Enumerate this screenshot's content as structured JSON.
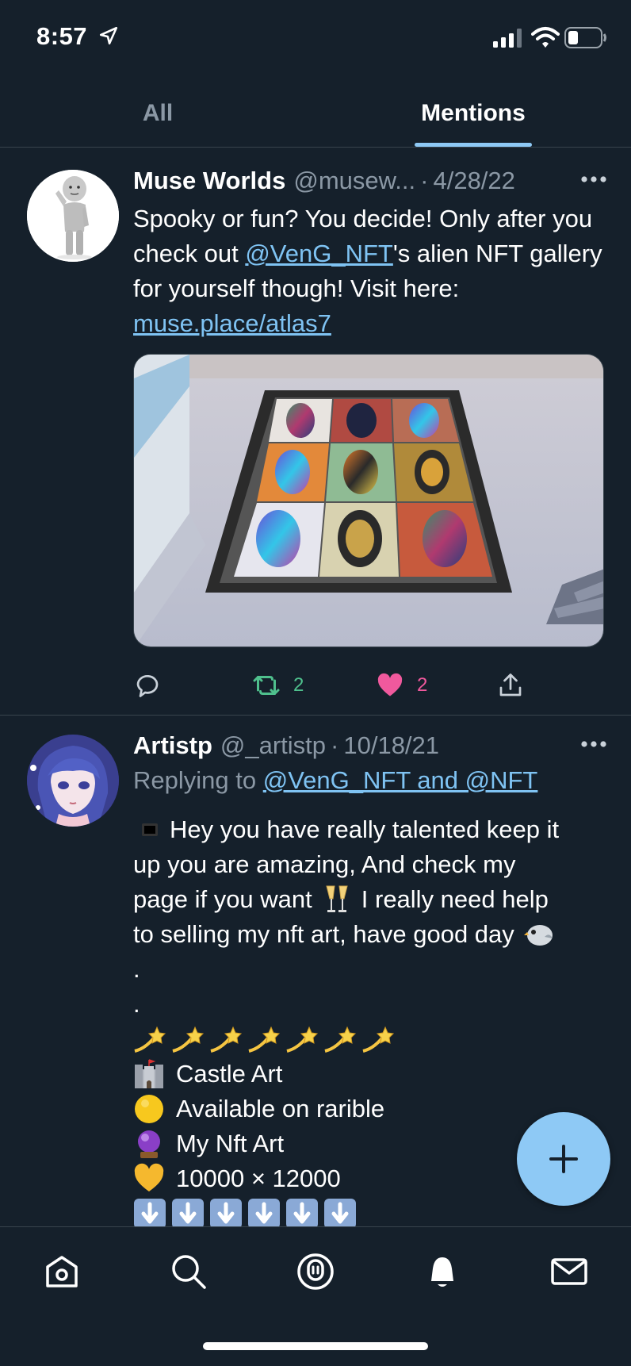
{
  "status_bar": {
    "time": "8:57"
  },
  "tabs": [
    {
      "label": "All",
      "active": false
    },
    {
      "label": "Mentions",
      "active": true
    }
  ],
  "tweets": [
    {
      "name": "Muse Worlds",
      "handle": "@musew...",
      "separator": "·",
      "date": "4/28/22",
      "text_parts": {
        "p1": "Spooky or fun? You decide! Only after you check out ",
        "mention": "@VenG_NFT",
        "p2": "'s alien NFT gallery for yourself though! Visit here: ",
        "url": "muse.place/atlas7"
      },
      "retweets": "2",
      "likes": "2"
    },
    {
      "name": "Artistp",
      "handle": "@_artistp",
      "separator": "·",
      "date": "10/18/21",
      "reply_prefix": "Replying to ",
      "reply_targets": "@VenG_NFT and @NFT",
      "lines": [
        "Hey you have really talented keep it",
        "up you are amazing, And check my",
        "page if you want",
        "I really need help",
        "to selling my nft art, have good day",
        ".",
        ".",
        "Castle Art",
        "Available on rarible",
        "My Nft Art",
        "10000 × 12000"
      ]
    }
  ],
  "colors": {
    "background": "#15202b",
    "accent": "#8ec9f5",
    "link": "#7fc3f3",
    "retweet": "#4fc08d",
    "like": "#f0599d",
    "muted": "#8b98a5"
  }
}
